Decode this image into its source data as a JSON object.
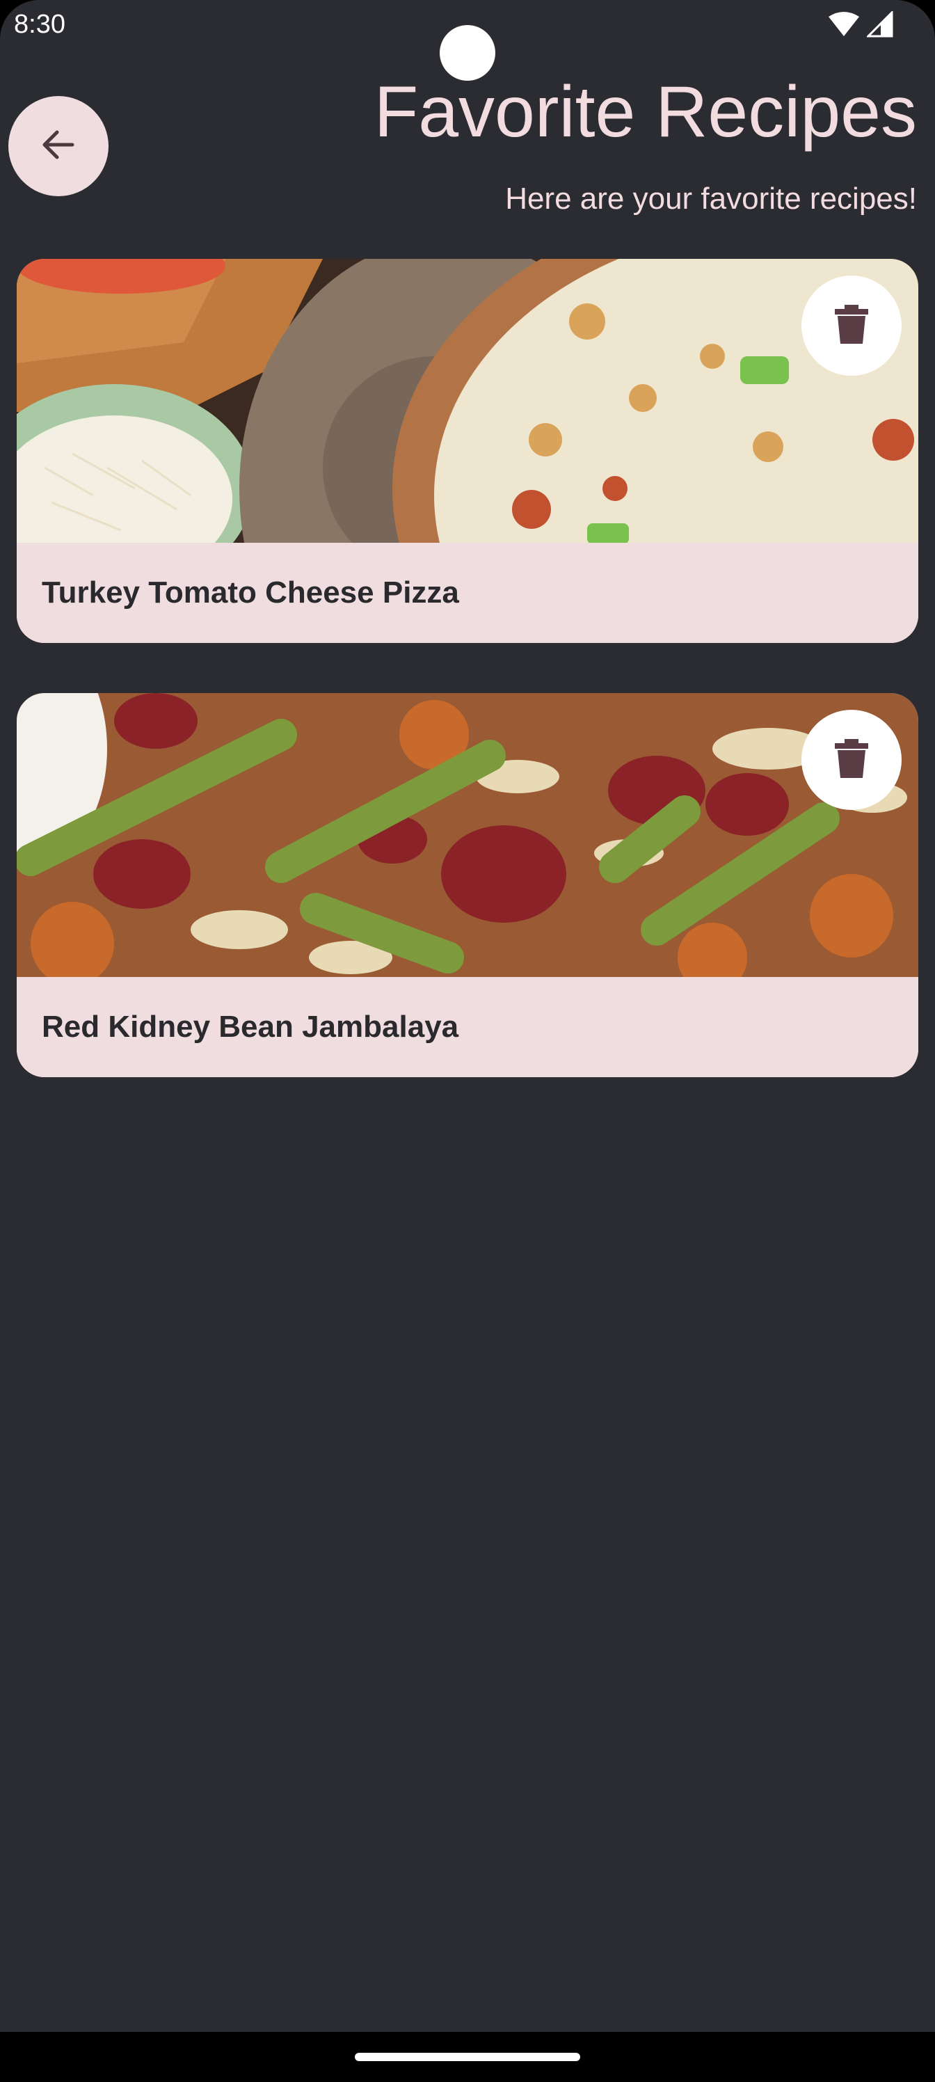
{
  "status_bar": {
    "time": "8:30",
    "icons": [
      "wifi-icon",
      "cell-signal-icon"
    ]
  },
  "header": {
    "back_icon": "arrow-left-icon",
    "title": "Favorite Recipes",
    "subtitle": "Here are your favorite recipes!"
  },
  "recipes": [
    {
      "name": "Turkey Tomato Cheese Pizza",
      "image_icon": "pizza-photo",
      "action_icon": "trash-icon"
    },
    {
      "name": "Red Kidney Bean Jambalaya",
      "image_icon": "jambalaya-photo",
      "action_icon": "trash-icon"
    }
  ],
  "colors": {
    "background": "#2b2c31",
    "card": "#f0dde0",
    "title_text": "#f2dcdf",
    "icon_dark": "#5a3c44"
  }
}
